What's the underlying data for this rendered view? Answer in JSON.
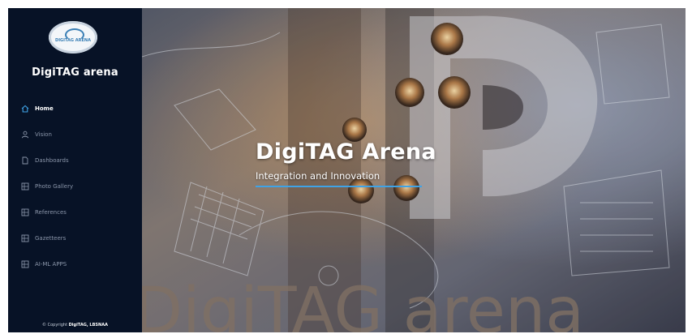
{
  "sidebar": {
    "logo_text": "DIGITAG ARENA",
    "brand": "DigiTAG arena",
    "items": [
      {
        "label": "Home",
        "icon": "home-icon",
        "active": true
      },
      {
        "label": "Vision",
        "icon": "user-icon",
        "active": false
      },
      {
        "label": "Dashboards",
        "icon": "document-icon",
        "active": false
      },
      {
        "label": "Photo Gallery",
        "icon": "grid-icon",
        "active": false
      },
      {
        "label": "References",
        "icon": "grid-icon",
        "active": false
      },
      {
        "label": "Gazetteers",
        "icon": "grid-icon",
        "active": false
      },
      {
        "label": "AI-ML APPS",
        "icon": "grid-icon",
        "active": false
      }
    ],
    "copyright_prefix": "© Copyright",
    "copyright_org": "DigiTAG, LBSNAA"
  },
  "hero": {
    "title": "DigiTAG Arena",
    "subtitle": "Integration and Innovation",
    "wall_text": "DigiTAG arena"
  },
  "colors": {
    "sidebar_bg": "#071226",
    "accent": "#3fa3e6",
    "nav_active": "#ffffff",
    "nav_inactive": "#8b96aa"
  }
}
